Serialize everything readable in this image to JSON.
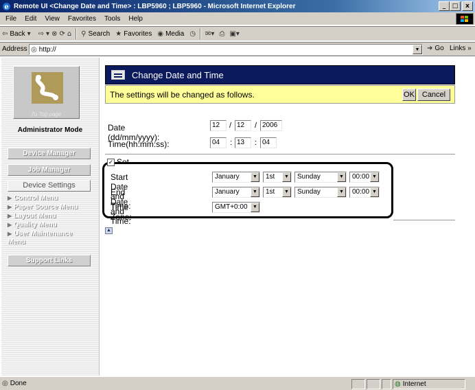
{
  "window": {
    "title": "Remote UI <Change Date and Time> : LBP5960 ; LBP5960 - Microsoft Internet Explorer",
    "min": "_",
    "max": "□",
    "close": "x"
  },
  "menubar": [
    "File",
    "Edit",
    "View",
    "Favorites",
    "Tools",
    "Help"
  ],
  "toolbar": {
    "back": "Back",
    "search": "Search",
    "favorites": "Favorites",
    "media": "Media"
  },
  "address": {
    "label": "Address",
    "value": "http://",
    "go": "Go",
    "links": "Links"
  },
  "left_panel": {
    "logo_label": "To Top page",
    "mode": "Administrator Mode",
    "nav": [
      "Device Manager",
      "Job Manager",
      "Device Settings"
    ],
    "menus": [
      "Control Menu",
      "Paper Source Menu",
      "Layout Menu",
      "Quality Menu",
      "User Maintenance Menu"
    ],
    "support": "Support Links"
  },
  "main": {
    "header": "Change Date and Time",
    "notice": "The settings will be changed as follows.",
    "ok": "OK",
    "cancel": "Cancel",
    "date_label": "Date (dd/mm/yyyy):",
    "date_d": "12",
    "date_m": "12",
    "date_y": "2006",
    "date_sep1": "/",
    "date_sep2": "/",
    "time_label": "Time(hh:mm:ss):",
    "time_h": "04",
    "time_m": "13",
    "time_s": "04",
    "time_sep": ":",
    "dst_label": "Set Daylight Saving Time",
    "start_label": "Start Date and Time:",
    "end_label": "End Date and Time:",
    "start": {
      "month": "January",
      "day": "1st",
      "weekday": "Sunday",
      "time": "00:00"
    },
    "end": {
      "month": "January",
      "day": "1st",
      "weekday": "Sunday",
      "time": "00:00"
    },
    "tz_label": "Time Zone:",
    "tz": "GMT+0:00"
  },
  "status": {
    "left": "Done",
    "zone": "Internet"
  }
}
